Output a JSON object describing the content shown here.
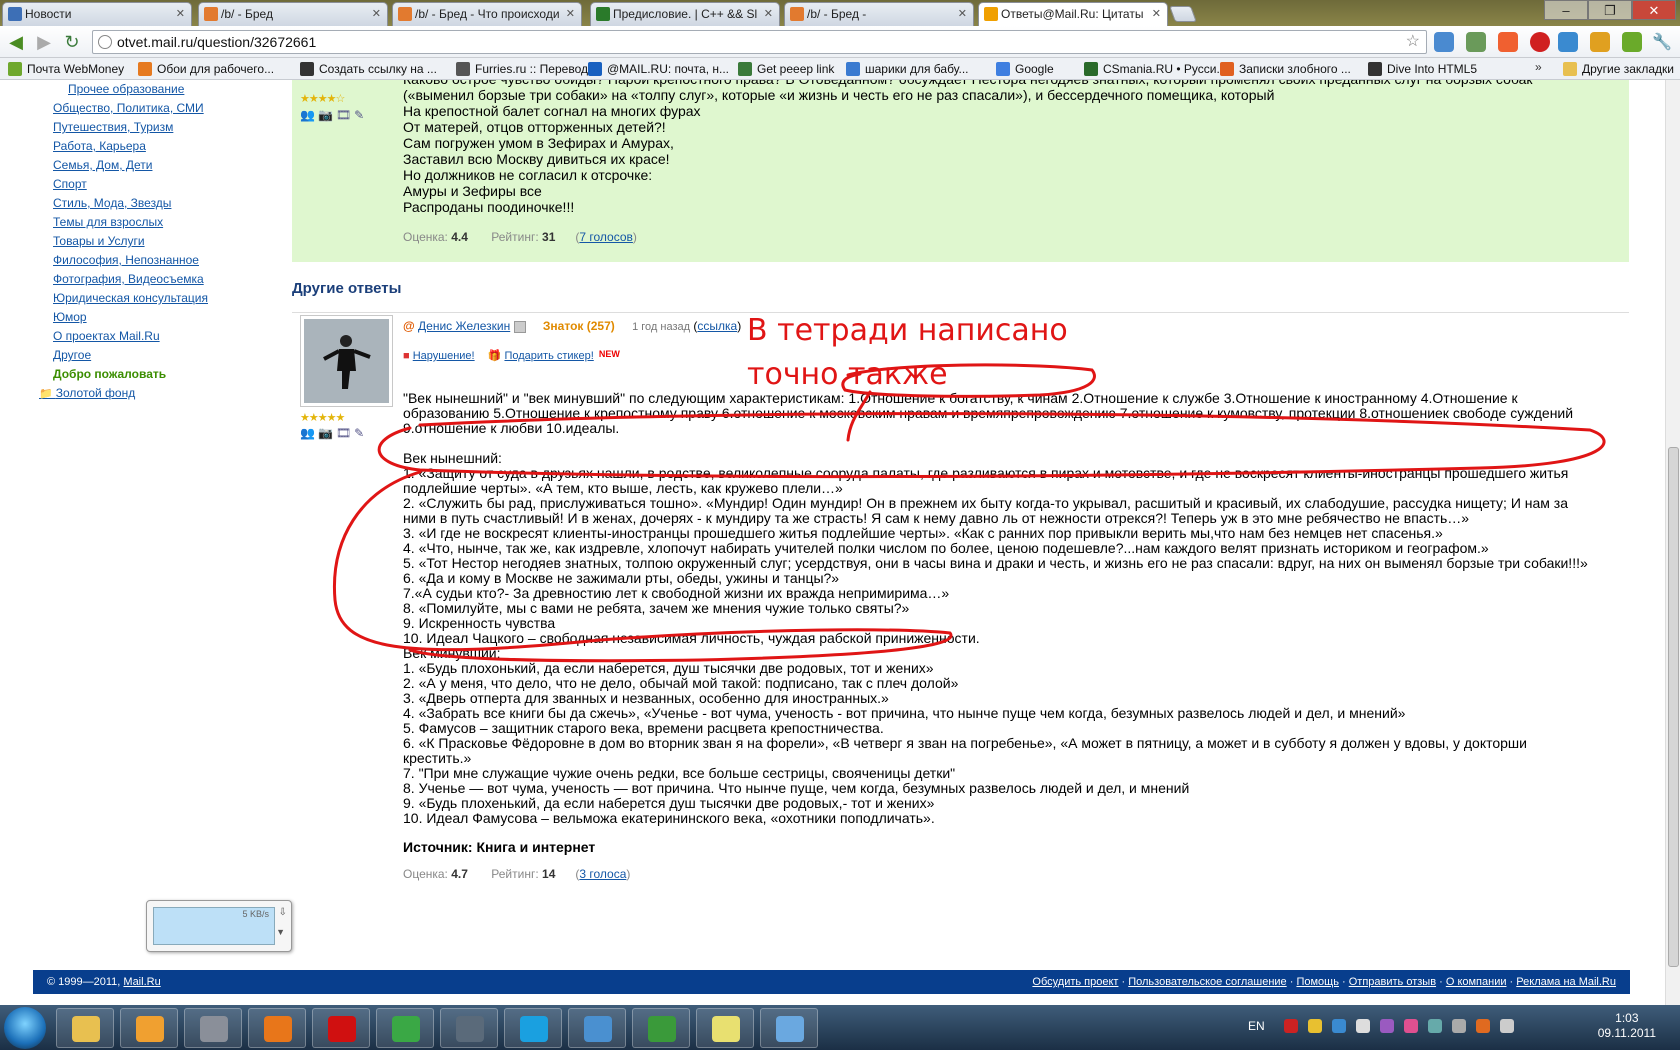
{
  "browser": {
    "tabs": [
      {
        "label": "Новости",
        "icon_color": "#3d6fb6"
      },
      {
        "label": "/b/ - Бред",
        "icon_color": "#e27a2f"
      },
      {
        "label": "/b/ - Бред - Что происходи",
        "icon_color": "#e27a2f"
      },
      {
        "label": "Предисловие. | C++ && Sl",
        "icon_color": "#2a7a2a"
      },
      {
        "label": "/b/ - Бред -",
        "icon_color": "#e27a2f"
      },
      {
        "label": "Ответы@Mail.Ru: Цитаты",
        "icon_color": "#f0a000"
      }
    ],
    "url": "otvet.mail.ru/question/32672661",
    "bookmarks": [
      {
        "label": "Почта WebMoney",
        "icon_color": "#6fa82e"
      },
      {
        "label": "Обои для рабочего...",
        "icon_color": "#e67a20"
      },
      {
        "label": "Создать ссылку на ...",
        "icon_color": "#333333"
      },
      {
        "label": "Furries.ru :: Перевод...",
        "icon_color": "#555555"
      },
      {
        "label": "@MAIL.RU: почта, н...",
        "icon_color": "#1860c0"
      },
      {
        "label": "Get peeep link",
        "icon_color": "#3a7a3a"
      },
      {
        "label": "шарики для бабу...",
        "icon_color": "#3a7ad0"
      },
      {
        "label": "Google",
        "icon_color": "#3f7fe0"
      },
      {
        "label": "CSmania.RU • Русси...",
        "icon_color": "#2a6a2a"
      },
      {
        "label": "Записки злобного ...",
        "icon_color": "#e06020"
      },
      {
        "label": "Dive Into HTML5",
        "icon_color": "#333333"
      },
      {
        "label": "Другие закладки",
        "icon_color": "#e8c050"
      }
    ]
  },
  "sidebar": {
    "items": [
      {
        "label": "Прочее образование",
        "style": "sub"
      },
      {
        "label": "Общество, Политика, СМИ",
        "style": "link"
      },
      {
        "label": "Путешествия, Туризм",
        "style": "link"
      },
      {
        "label": "Работа, Карьера",
        "style": "link"
      },
      {
        "label": "Семья, Дом, Дети",
        "style": "link"
      },
      {
        "label": "Спорт",
        "style": "link"
      },
      {
        "label": "Стиль, Мода, Звезды",
        "style": "link"
      },
      {
        "label": "Темы для взрослых",
        "style": "link"
      },
      {
        "label": "Товары и Услуги",
        "style": "link"
      },
      {
        "label": "Философия, Непознанное",
        "style": "link"
      },
      {
        "label": "Фотография, Видеосъемка",
        "style": "link"
      },
      {
        "label": "Юридическая консультация",
        "style": "link"
      },
      {
        "label": "Юмор",
        "style": "link"
      },
      {
        "label": "О проектах Mail.Ru",
        "style": "link"
      },
      {
        "label": "Другое",
        "style": "link"
      },
      {
        "label": "Добро пожаловать",
        "style": "green"
      },
      {
        "label": "Золотой фонд",
        "style": "gold"
      }
    ]
  },
  "answer1": {
    "lines": [
      "Каково острое чувство обиды? Нарой крепостного права? В Отоведанном? обсуждает Нестора негодяев знатных, который променял своих преданных слуг на борзых собак",
      "(«выменил борзые три собаки» на «толпу слуг», которые «и жизнь и честь его не раз спасали»), и бессердечного помещика, который",
      "На крепостной балет согнал на многих фурах",
      "От матерей, отцов отторженных детей?!",
      "Сам погружен умом в Зефирах и Амурах,",
      "Заставил всю Москву дивиться их красе!",
      "Но должников не согласил к отсрочке:",
      "Амуры и Зефиры все",
      "Распроданы поодиночке!!!"
    ],
    "rating_label": "Оценка:",
    "rating_value": "4.4",
    "score_label": "Рейтинг:",
    "score_value": "31",
    "votes": "7 голосов",
    "rating_stars": 4.4
  },
  "other_answers_title": "Другие ответы",
  "answer2": {
    "author": "Денис Железкин",
    "rank": "Знаток (257)",
    "time": "1 год назад",
    "link": "ссылка",
    "action_violation": "Нарушение!",
    "action_sticker": "Подарить стикер!",
    "new_badge": "NEW",
    "lines": [
      "\"Век нынешний\" и \"век минувший\" по следующим характеристикам: 1.Отношение к богатству, к чинам 2.Отношение к службе 3.Отношение к иностранному 4.Отношение к",
      "образованию 5.Отношение к крепостному праву 6.отношение к московским нравам и времяпрепровождению 7.отношение к кумовству, протекции 8.отношениек свободе суждений",
      "9.отношение к любви 10.идеалы.",
      "",
      "Век нынешний:",
      "1. «Защиту от суда в друзьях нашли, в родстве, великолепные сооруда палаты, где разливаются в пирах и мотовстве, и где не воскресят клиенты-иностранцы прошедшего житья",
      "подлейшие черты». «А тем, кто выше, лесть, как кружево плели…»",
      "2. «Служить бы рад, прислуживаться тошно». «Мундир! Один мундир! Он в прежнем их быту когда-то укрывал, расшитый и красивый, их слабодушие, рассудка нищету; И нам за",
      "ними в путь счастливый! И в женах, дочерях - к мундиру та же страсть! Я сам к нему давно ль от нежности отрекся?! Теперь уж в это мне ребячество не впасть…»",
      "3. «И где не воскресят клиенты-иностранцы прошедшего житья подлейшие черты». «Как с ранних пор привыкли верить мы,что нам без немцев нет спасенья.»",
      "4. «Что, нынче, так же, как издревле, хлопочут набирать учителей полки числом по более, ценою подешевле?...нам каждого велят признать историком и географом.»",
      "5. «Тот Нестор негодяев знатных, толпою окруженный слуг; усердствуя, они в часы вина и драки и честь, и жизнь его не раз спасали: вдруг, на них он выменял борзые три собаки!!!»",
      "6. «Да и кому в Москве не зажимали рты, обеды, ужины и танцы?»",
      "7.«А судьи кто?- За древностию лет к свободной жизни их вражда непримирима…»",
      "8. «Помилуйте, мы с вами не ребята, зачем же мнения чужие только святы?»",
      "9. Искренность чувства",
      "10. Идеал Чацкого – свободная независимая личность, чуждая рабской приниженности.",
      "Век минувший:",
      "1. «Будь плохонький, да если наберется, душ тысячки две родовых, тот и жених»",
      "2. «А у меня, что дело, что не дело, обычай мой такой: подписано, так с плеч долой»",
      "3. «Дверь отперта для званных и незванных, особенно для иностранных.»",
      "4. «Забрать все книги бы да сжечь», «Ученье - вот чума, ученость - вот причина, что нынче пуще чем когда, безумных развелось людей и дел, и мнений»",
      "5. Фамусов – защитник старого века, времени расцвета крепостничества.",
      "6. «К Прасковье Фёдоровне в дом во вторник зван я на форели», «В четверг я зван на погребенье», «А может в пятницу, а может и в субботу я должен у вдовы, у докторши",
      "крестить.»",
      "7. \"При мне служащие чужие очень редки, все больше сестрицы, свояченицы детки\"",
      "8. Ученье — вот чума, ученость — вот причина. Что нынче пуще, чем когда, безумных развелось людей и дел, и мнений",
      "9. «Будь плохенький, да если наберется душ тысячки две родовых,- тот и жених»",
      "10. Идеал Фамусова – вельможа екатерининского века, «охотники поподличать»."
    ],
    "source": "Источник: Книга и интернет",
    "rating_label": "Оценка:",
    "rating_value": "4.7",
    "score_label": "Рейтинг:",
    "score_value": "14",
    "votes": "3 голоса",
    "rating_stars": 4.7
  },
  "annotation": {
    "text": "В тетради написано точно также",
    "color": "#e01515"
  },
  "net_widget": {
    "speed": "5 KB/s"
  },
  "footer": {
    "copyright": "© 1999—2011,",
    "brand": "Mail.Ru",
    "links": [
      "Обсудить проект",
      "Пользовательское соглашение",
      "Помощь",
      "Отправить отзыв",
      "О компании",
      "Реклама на Mail.Ru"
    ]
  },
  "taskbar": {
    "language": "EN",
    "time": "1:03",
    "date": "09.11.2011",
    "apps": [
      {
        "name": "explorer",
        "color": "#e8c050"
      },
      {
        "name": "media-player",
        "color": "#f0a030"
      },
      {
        "name": "game",
        "color": "#8a8f99"
      },
      {
        "name": "firefox",
        "color": "#e8761a"
      },
      {
        "name": "opera",
        "color": "#d01010"
      },
      {
        "name": "chrome",
        "color": "#3aa845"
      },
      {
        "name": "steam",
        "color": "#5a6a7a"
      },
      {
        "name": "skype",
        "color": "#1aa0e0"
      },
      {
        "name": "downloads",
        "color": "#4a90d0"
      },
      {
        "name": "utorrent",
        "color": "#3a9a3a"
      },
      {
        "name": "notepad",
        "color": "#e8e070"
      },
      {
        "name": "messenger",
        "color": "#6aa8e0"
      }
    ]
  }
}
